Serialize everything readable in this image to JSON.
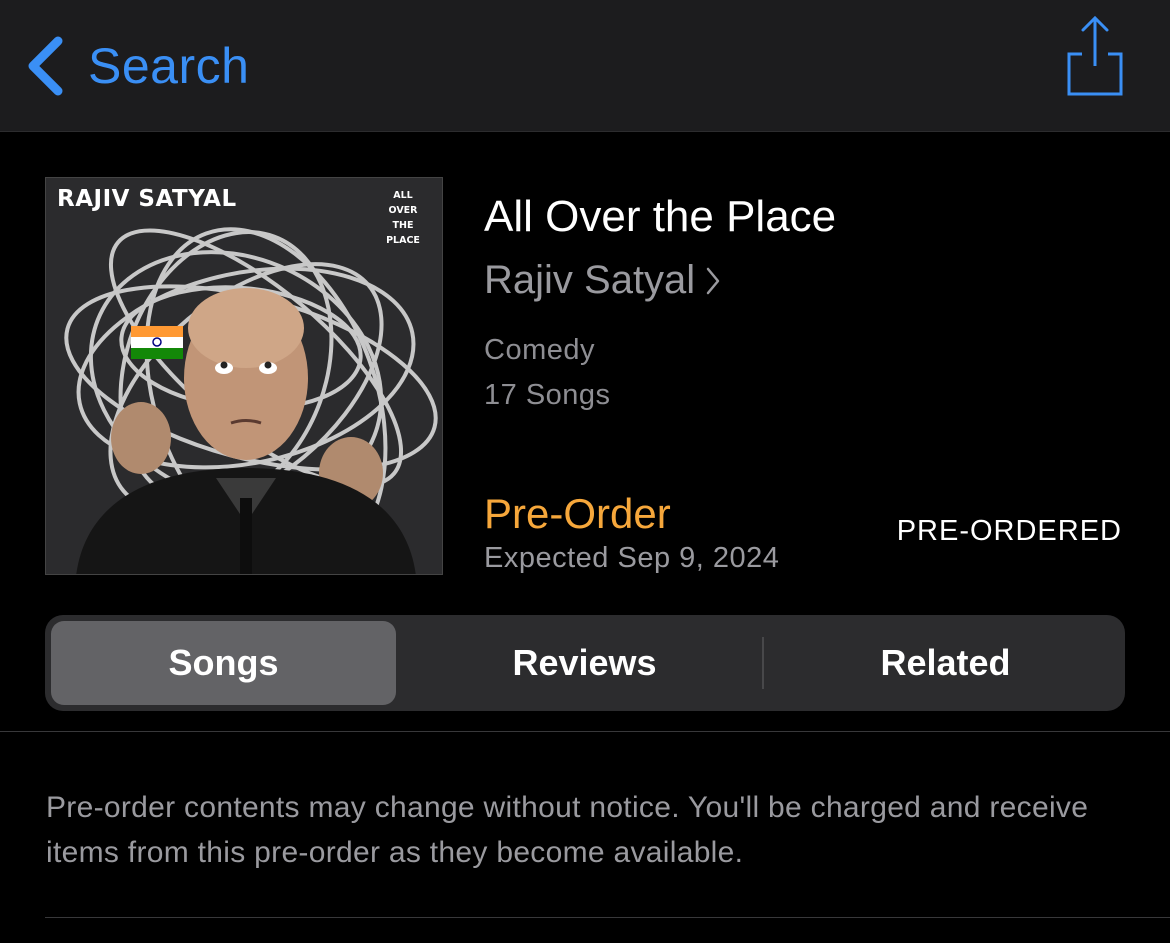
{
  "nav": {
    "back_label": "Search"
  },
  "album": {
    "artwork": {
      "artist_text": "RAJIV SATYAL",
      "title_text": "ALL OVER THE PLACE"
    },
    "title": "All Over the Place",
    "artist": "Rajiv Satyal",
    "genre": "Comedy",
    "song_count": "17 Songs",
    "preorder_label": "Pre-Order",
    "expected": "Expected Sep 9, 2024",
    "status": "PRE-ORDERED"
  },
  "tabs": [
    {
      "label": "Songs",
      "active": true
    },
    {
      "label": "Reviews",
      "active": false
    },
    {
      "label": "Related",
      "active": false
    }
  ],
  "notice": "Pre-order contents may change without notice. You'll be charged and receive items from this pre-order as they become available.",
  "colors": {
    "accent_blue": "#3a8ff5",
    "preorder_orange": "#f6a73b"
  }
}
